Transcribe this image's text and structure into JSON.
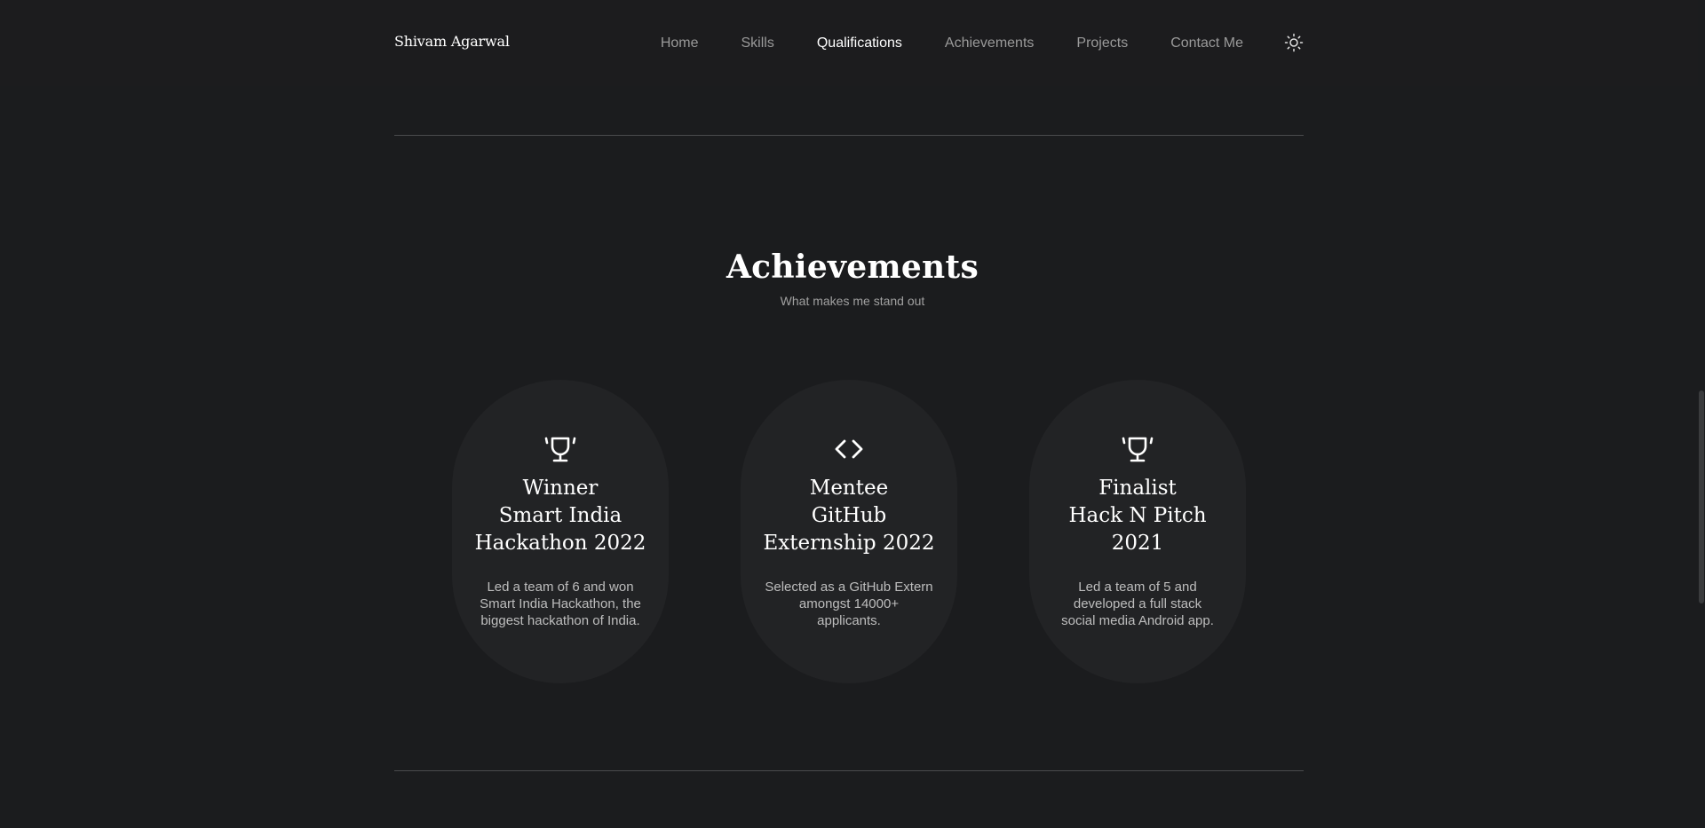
{
  "nav": {
    "brand": "Shivam Agarwal",
    "links": [
      {
        "label": "Home"
      },
      {
        "label": "Skills"
      },
      {
        "label": "Qualifications"
      },
      {
        "label": "Achievements"
      },
      {
        "label": "Projects"
      },
      {
        "label": "Contact Me"
      }
    ],
    "active": "Qualifications",
    "theme_toggle_icon": "sun-icon"
  },
  "section": {
    "title": "Achievements",
    "subtitle": "What makes me stand out"
  },
  "achievements": [
    {
      "icon": "trophy-icon",
      "title_lines": [
        "Winner",
        "Smart India",
        "Hackathon 2022"
      ],
      "desc_lines": [
        "Led a team of 6 and won",
        "Smart India Hackathon, the",
        "biggest hackathon of India."
      ]
    },
    {
      "icon": "code-icon",
      "title_lines": [
        "Mentee",
        "GitHub",
        "Externship 2022"
      ],
      "desc_lines": [
        "Selected as a GitHub Extern",
        "amongst 14000+",
        "applicants."
      ]
    },
    {
      "icon": "trophy-icon",
      "title_lines": [
        "Finalist",
        "Hack N Pitch",
        "2021"
      ],
      "desc_lines": [
        "Led a team of 5 and",
        "developed a full stack",
        "social media Android app."
      ]
    }
  ],
  "colors": {
    "background": "#1b1c1e",
    "card": "#222325",
    "accent_text": "#ffffff",
    "muted_text": "#9a9a9a"
  }
}
